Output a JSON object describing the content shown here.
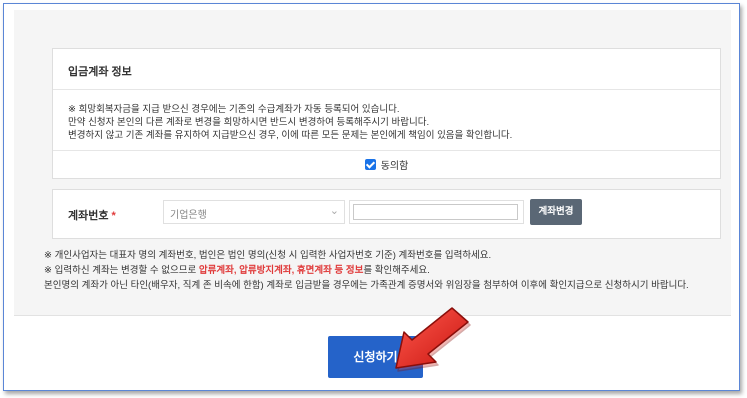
{
  "consent": {
    "title": "입금계좌 정보",
    "notices": [
      "※ 희망회복자금을 지급 받으신 경우에는 기존의 수급계좌가 자동 등록되어 있습니다.",
      "만약 신청자 본인의 다른 계좌로 변경을 희망하시면 반드시 변경하여 등록해주시기 바랍니다.",
      "변경하지 않고 기존 계좌를 유지하여 지급받으신 경우, 이에 따른 모든 문제는 본인에게 책임이 있음을 확인합니다."
    ],
    "agree_label": "동의함",
    "agree_checked": true
  },
  "account": {
    "label": "계좌번호",
    "required_mark": "*",
    "bank_selected": "기업은행",
    "account_number": "",
    "change_button": "계좌변경"
  },
  "guides": {
    "line1": "※ 개인사업자는 대표자 명의 계좌번호, 법인은 법인 명의(신청 시 입력한 사업자번호 기준) 계좌번호를 입력하세요.",
    "line2_pre": "※ 입력하신 계좌는 변경할 수 없으므로 ",
    "line2_highlight": "압류계좌, 압류방지계좌, 휴면계좌 등 정보",
    "line2_post": "를 확인해주세요.",
    "line3": "본인명의 계좌가 아닌 타인(배우자, 직계 존 비속에 한함) 계좌로 입금받을 경우에는 가족관계 증명서와 위임장을 첨부하여 이후에 확인지급으로 신청하시기 바랍니다."
  },
  "submit": {
    "label": "신청하기"
  },
  "colors": {
    "accent": "#2563c9",
    "highlight": "#e03a3a",
    "arrow": "#e8231d"
  }
}
